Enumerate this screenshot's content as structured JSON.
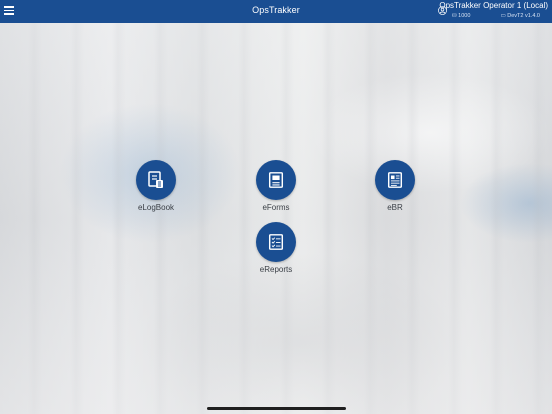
{
  "header": {
    "menu_icon": "hamburger-menu-icon",
    "title": "OpsTrakker",
    "user_icon": "user-circle-icon",
    "user_name": "OpsTrakker Operator 1 (Local)",
    "site_code": "1000",
    "version": "DevT2 v1.4.0"
  },
  "tiles": [
    {
      "label": "eLogBook",
      "icon": "logbook-icon"
    },
    {
      "label": "eForms",
      "icon": "form-icon"
    },
    {
      "label": "eBR",
      "icon": "batch-record-icon"
    },
    {
      "label": "eReports",
      "icon": "checklist-report-icon"
    }
  ],
  "colors": {
    "brand": "#1a4e92",
    "label_text": "#3a3f46"
  }
}
